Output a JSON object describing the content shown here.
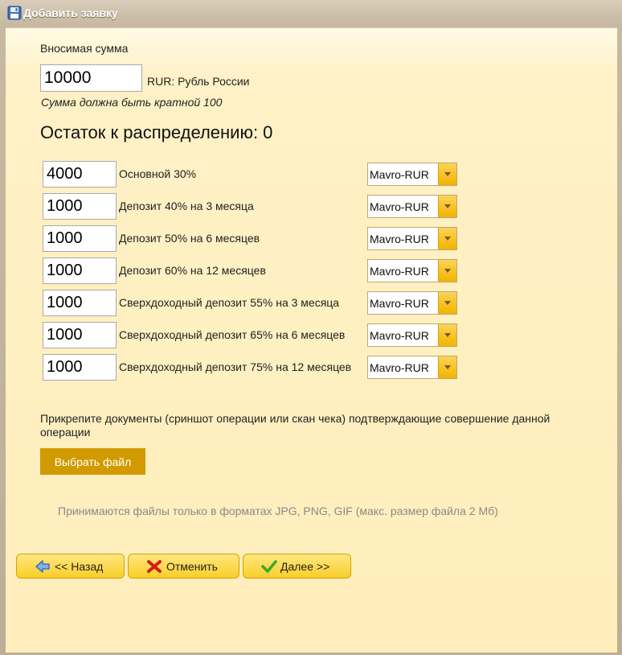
{
  "window": {
    "title": "Добавить заявку"
  },
  "form": {
    "amount_label": "Вносимая сумма",
    "amount_value": "10000",
    "currency": "RUR: Рубль России",
    "hint": "Сумма должна быть кратной 100",
    "remaining_label": "Остаток к распределению: 0"
  },
  "rows": [
    {
      "value": "4000",
      "label": "Основной 30%",
      "currency": "Mavro-RUR"
    },
    {
      "value": "1000",
      "label": "Депозит 40% на 3 месяца",
      "currency": "Mavro-RUR"
    },
    {
      "value": "1000",
      "label": "Депозит 50% на 6 месяцев",
      "currency": "Mavro-RUR"
    },
    {
      "value": "1000",
      "label": "Депозит 60% на 12 месяцев",
      "currency": "Mavro-RUR"
    },
    {
      "value": "1000",
      "label": "Сверхдоходный депозит 55% на 3 месяца",
      "currency": "Mavro-RUR"
    },
    {
      "value": "1000",
      "label": "Сверхдоходный депозит 65% на 6 месяцев",
      "currency": "Mavro-RUR"
    },
    {
      "value": "1000",
      "label": "Сверхдоходный депозит 75% на 12 месяцев",
      "currency": "Mavro-RUR"
    }
  ],
  "attach": {
    "text": "Прикрепите документы (сриншот операции или скан чека) подтверждающие совершение данной операции",
    "button": "Выбрать файл",
    "formats": "Принимаются файлы только в форматах JPG, PNG, GIF (макс. размер файла 2 Мб)"
  },
  "nav": {
    "back": "<< Назад",
    "cancel": "Отменить",
    "next": "Далее >>"
  },
  "icons": {
    "title": "floppy-disk-icon",
    "back": "arrow-left-icon",
    "cancel": "red-x-icon",
    "next": "green-check-icon"
  },
  "colors": {
    "file_button": "#d19a00",
    "nav_button": "#f9cf2a",
    "content_bg": "#ffeebb"
  }
}
